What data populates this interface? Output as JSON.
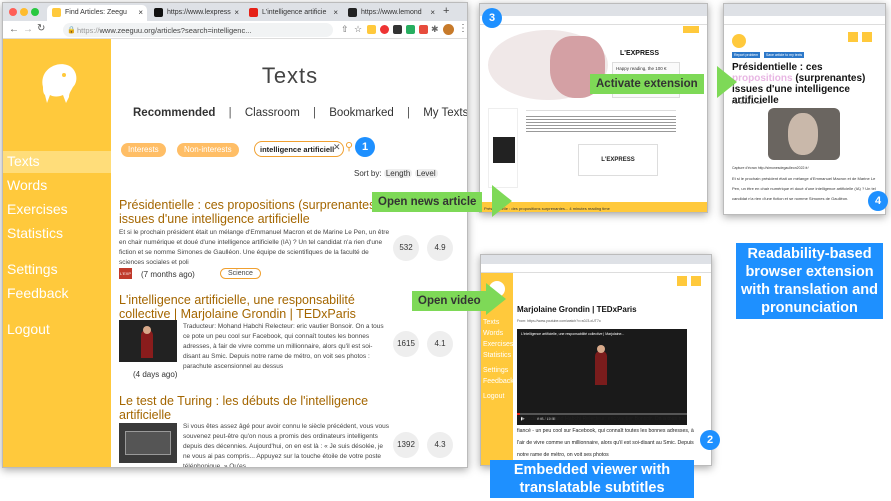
{
  "browser": {
    "tabs": [
      {
        "label": "Find Articles: Zeegu"
      },
      {
        "label": "https://www.lexpress"
      },
      {
        "label": "L'intelligence artificie"
      },
      {
        "label": "https://www.lemond"
      }
    ],
    "url_prefix": "https://",
    "url": "www.zeeguu.org/articles?search=intelligenc..."
  },
  "sidebar": {
    "items": [
      "Texts",
      "Words",
      "Exercises",
      "Statistics",
      "Settings",
      "Feedback",
      "Logout"
    ]
  },
  "page": {
    "title": "Texts",
    "nav": [
      "Recommended",
      "Classroom",
      "Bookmarked",
      "My Texts"
    ],
    "separator": "|",
    "filters": [
      "Interests",
      "Non-interests"
    ],
    "search_value": "intelligence artificiell",
    "sort_label": "Sort by:",
    "sort_options": [
      "Length",
      "Level"
    ]
  },
  "articles": [
    {
      "title": "Présidentielle : ces propositions (surprenantes) issues d'une intelligence artificielle",
      "summary": "Et si le prochain président était un mélange d'Emmanuel Macron et de Marine Le Pen, un être en chair numérique et doué d'une intelligence artificielle (IA) ? Un tel candidat n'a rien d'une fiction et se nomme Simones de Gaulléon. Une équipe de scientifiques de la faculté de sciences sociales et poli",
      "source_logo": "L'EXP",
      "age": "(7 months ago)",
      "tag": "Science",
      "words": "532",
      "level": "4.9"
    },
    {
      "title": "L'intelligence artificielle, une responsabilité collective | Marjolaine Grondin | TEDxParis",
      "summary": "Traducteur: Mohand Habchi Relecteur: eric vautier Bonsoir. On a tous ce pote un peu cool sur Facebook, qui connaît toutes les bonnes adresses, à fair de vivre comme un millionnaire, alors qu'il est soi-disant au Smic. Depuis notre rame de métro, on voit ses photos : parachute ascensionnel au dessus",
      "age": "(4 days ago)",
      "words": "1615",
      "level": "4.1"
    },
    {
      "title": "Le test de Turing : les débuts de l'intelligence artificielle",
      "summary": "Si vous êtes assez âgé pour avoir connu le siècle précédent, vous vous souvenez peut-être qu'on nous a promis des ordinateurs intelligents depuis des décennies. Aujourd'hui, on en est là : « Je suis désolée, je ne vous ai pas compris... Appuyez sur la touche étoile de votre poste téléphonique. » Qu'es",
      "words": "1392",
      "level": "4.3"
    }
  ],
  "annotations": {
    "badges": [
      "1",
      "2",
      "3",
      "4"
    ],
    "open_news": "Open news article",
    "activate": "Activate extension",
    "open_video": "Open video",
    "readability": "Readability-based browser extension with translation and pronunciation",
    "embedded": "Embedded viewer with translatable subtitles"
  },
  "screenshot3": {
    "logo": "L'EXPRESS",
    "promo": "Happy reading, the 100 €",
    "btn": "Read article",
    "footer": "Présidentielle : des propositions surprenantes... 4 minutes reading time"
  },
  "screenshot4": {
    "chip1": "Report problem",
    "chip2": "Save article to my texts",
    "title_a": "Présidentielle : ces",
    "title_b": "propositions",
    "title_c": "(surprenantes) issues d'une intelligence artificielle",
    "byline": "Par Bruno D. Cot",
    "caption": "Capture d'écran http://simonesdegaulleon2022.fr/",
    "body": "Et si le prochain président était un mélange d'Emmanuel Macron et de Marine Le Pen, un être en chair numérique et doué d'une intelligence artificielle (IA) ? Un tel candidat n'a rien d'une fiction et se nomme Simones de Gaulléon."
  },
  "screenshot2": {
    "title": "Marjolaine Grondin | TEDxParis",
    "from": "From: https://www.youtube.com/watch?v=s0J3-xUT7o",
    "video_title": "L'intelligence artificielle, une responsabilité collective | Marjolaine...",
    "time": "0:01 / 15:55",
    "subtitle": "Traducteur: Mohand Habchi Relecteur: eric vautier Bonsoir. On a tous ma fiancé - un peu cool sur Facebook, qui connaît toutes les bonnes adresses, à l'air de vivre comme un millionnaire, alors qu'il est soi-disant au Smic. Depuis notre rame de métro, on voit ses photos"
  }
}
